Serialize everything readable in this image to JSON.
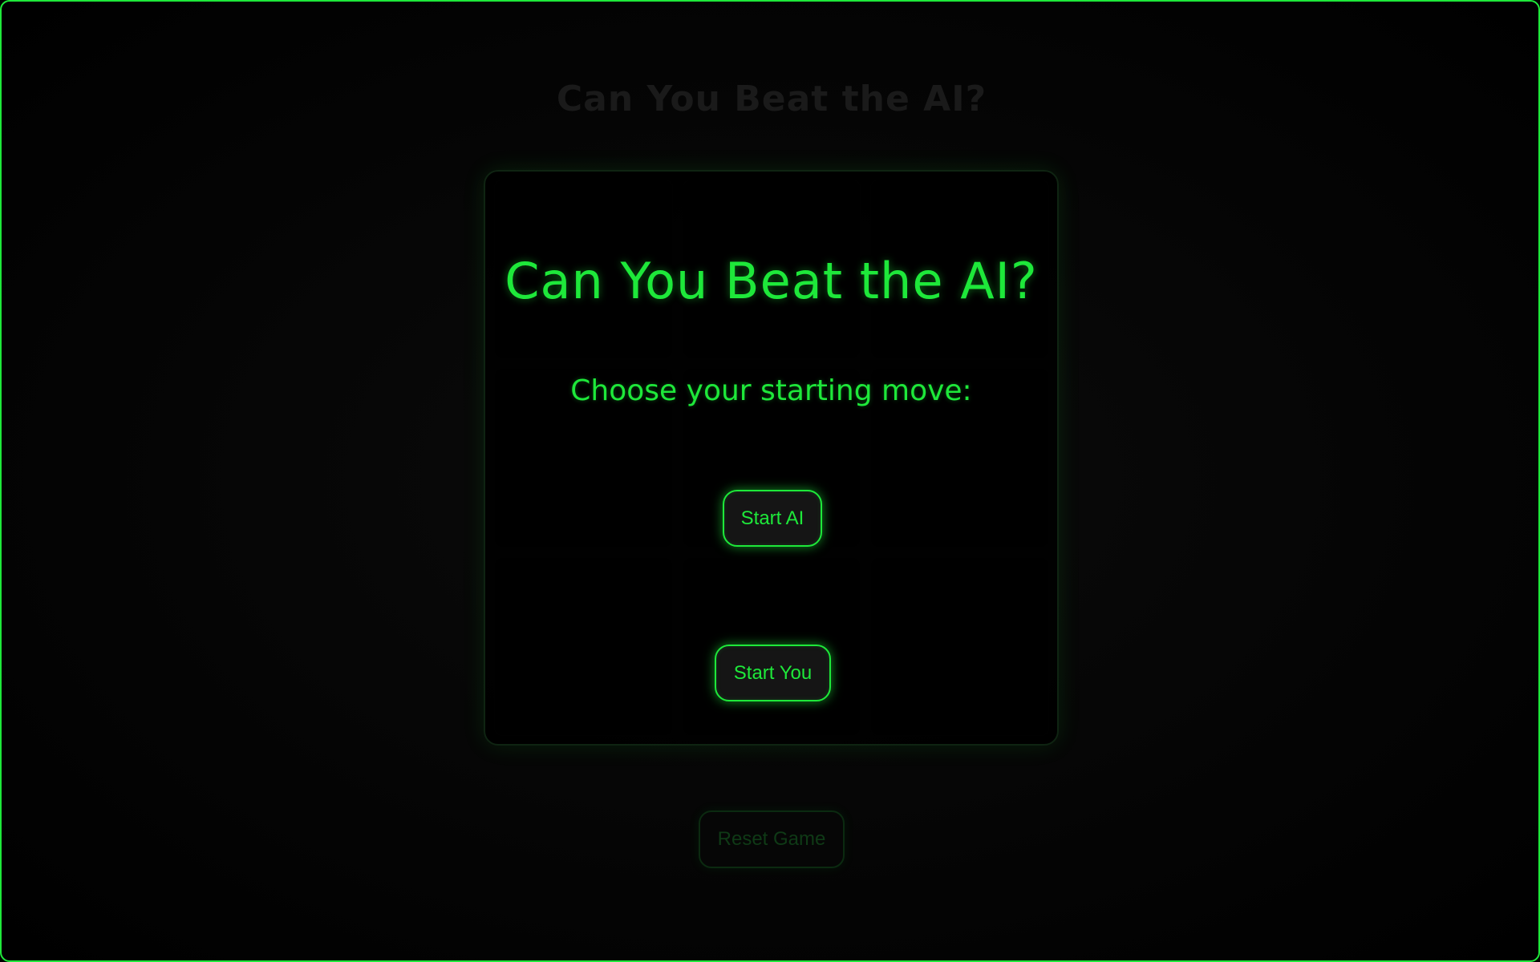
{
  "game": {
    "background_title": "Can You Beat the AI?",
    "reset_label": "Reset Game"
  },
  "modal": {
    "title": "Can You Beat the AI?",
    "subtitle": "Choose your starting move:",
    "start_ai_label": "Start AI",
    "start_you_label": "Start You"
  },
  "colors": {
    "accent": "#1ee83a",
    "background": "#000000"
  }
}
